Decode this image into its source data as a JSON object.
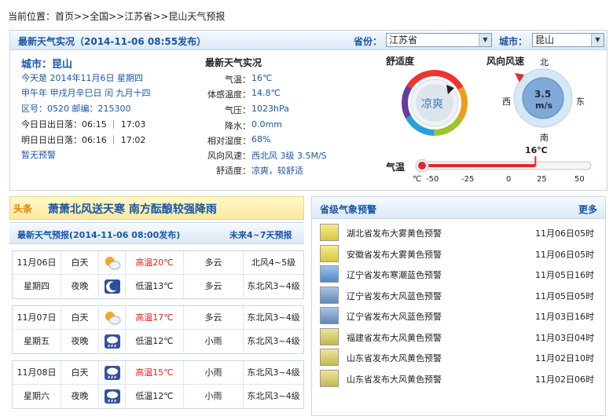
{
  "breadcrumb": {
    "prefix": "当前位置：",
    "path": "首页>>全国>>江苏省>>昆山天气预报"
  },
  "live": {
    "title": "最新天气实况（2014-11-06  08:55发布）",
    "province_label": "省份：",
    "province_value": "江苏省",
    "city_label": "城市：",
    "city_value": "昆山"
  },
  "city_info": {
    "city": "城市：昆山",
    "today": "今天是 2014年11月6日 星期四",
    "lunar": "甲午年 甲戌月辛巳日 闰 九月十四",
    "codes": "区号：0520  邮编：215300",
    "today_sun": "今日日出日落：06:15 ｜ 17:03",
    "tomorrow_sun": "明日日出日落：06:16 ｜ 17:02",
    "alert": "暂无预警"
  },
  "observation": {
    "heading": "最新天气实况",
    "rows": [
      {
        "label": "气温：",
        "value": "16℃"
      },
      {
        "label": "体感温度：",
        "value": "14.8℃"
      },
      {
        "label": "气压：",
        "value": "1023hPa"
      },
      {
        "label": "降水：",
        "value": "0.0mm"
      },
      {
        "label": "相对湿度：",
        "value": "68%"
      },
      {
        "label": "风向风速：",
        "value": "西北风 3级 3.5M/S"
      },
      {
        "label": "舒适度：",
        "value": "凉爽，较舒适"
      }
    ]
  },
  "comfort": {
    "title": "舒适度",
    "value": "凉爽"
  },
  "wind": {
    "title": "风向风速",
    "speed": "3.5",
    "unit": "m/s",
    "n": "北",
    "s": "南",
    "e": "东",
    "w": "西"
  },
  "thermo": {
    "label": "气温",
    "current": "16℃",
    "ticks": [
      "℃",
      "-50",
      "-25",
      "0",
      "25",
      "50"
    ],
    "value": 16,
    "min": -50,
    "max": 50
  },
  "news": {
    "tag": "头条",
    "headline": "萧萧北风送天寒  南方酝酿较强降雨"
  },
  "forecast": {
    "title": "最新天气预报(2014-11-06  08:00发布)",
    "more": "未来4~7天预报",
    "days": [
      {
        "date": "11月06日",
        "weekday": "星期四",
        "day": {
          "label": "白天",
          "icon": "sun-cloud-icon",
          "temp": "高温20℃",
          "weather": "多云",
          "wind": "北风4~5级"
        },
        "night": {
          "label": "夜晚",
          "icon": "moon-icon",
          "temp": "低温13℃",
          "weather": "多云",
          "wind": "东北风3~4级"
        }
      },
      {
        "date": "11月07日",
        "weekday": "星期五",
        "day": {
          "label": "白天",
          "icon": "sun-cloud-icon",
          "temp": "高温17℃",
          "weather": "多云",
          "wind": "东北风3~4级"
        },
        "night": {
          "label": "夜晚",
          "icon": "rain-icon",
          "temp": "低温12℃",
          "weather": "小雨",
          "wind": "东北风3~4级"
        }
      },
      {
        "date": "11月08日",
        "weekday": "星期六",
        "day": {
          "label": "白天",
          "icon": "rain-icon",
          "temp": "高温15℃",
          "weather": "小雨",
          "wind": "东北风3~4级"
        },
        "night": {
          "label": "夜晚",
          "icon": "rain-icon",
          "temp": "低温12℃",
          "weather": "小雨",
          "wind": "东北风3~4级"
        }
      }
    ]
  },
  "warnings": {
    "title": "省级气象预警",
    "more": "更多",
    "items": [
      {
        "text": "湖北省发布大雾黄色预警",
        "time": "11月06日05时",
        "icon": "fog-yellow-icon"
      },
      {
        "text": "安徽省发布大雾黄色预警",
        "time": "11月06日05时",
        "icon": "fog-yellow-icon"
      },
      {
        "text": "辽宁省发布寒潮蓝色预警",
        "time": "11月05日16时",
        "icon": "cold-wave-blue-icon"
      },
      {
        "text": "辽宁省发布大风蓝色预警",
        "time": "11月05日05时",
        "icon": "wind-blue-icon"
      },
      {
        "text": "辽宁省发布大风蓝色预警",
        "time": "11月03日16时",
        "icon": "wind-blue-icon"
      },
      {
        "text": "福建省发布大风黄色预警",
        "time": "11月03日04时",
        "icon": "wind-yellow-icon"
      },
      {
        "text": "山东省发布大风黄色预警",
        "time": "11月02日10时",
        "icon": "wind-yellow-icon"
      },
      {
        "text": "山东省发布大风黄色预警",
        "time": "11月02日06时",
        "icon": "wind-yellow-icon"
      }
    ]
  }
}
